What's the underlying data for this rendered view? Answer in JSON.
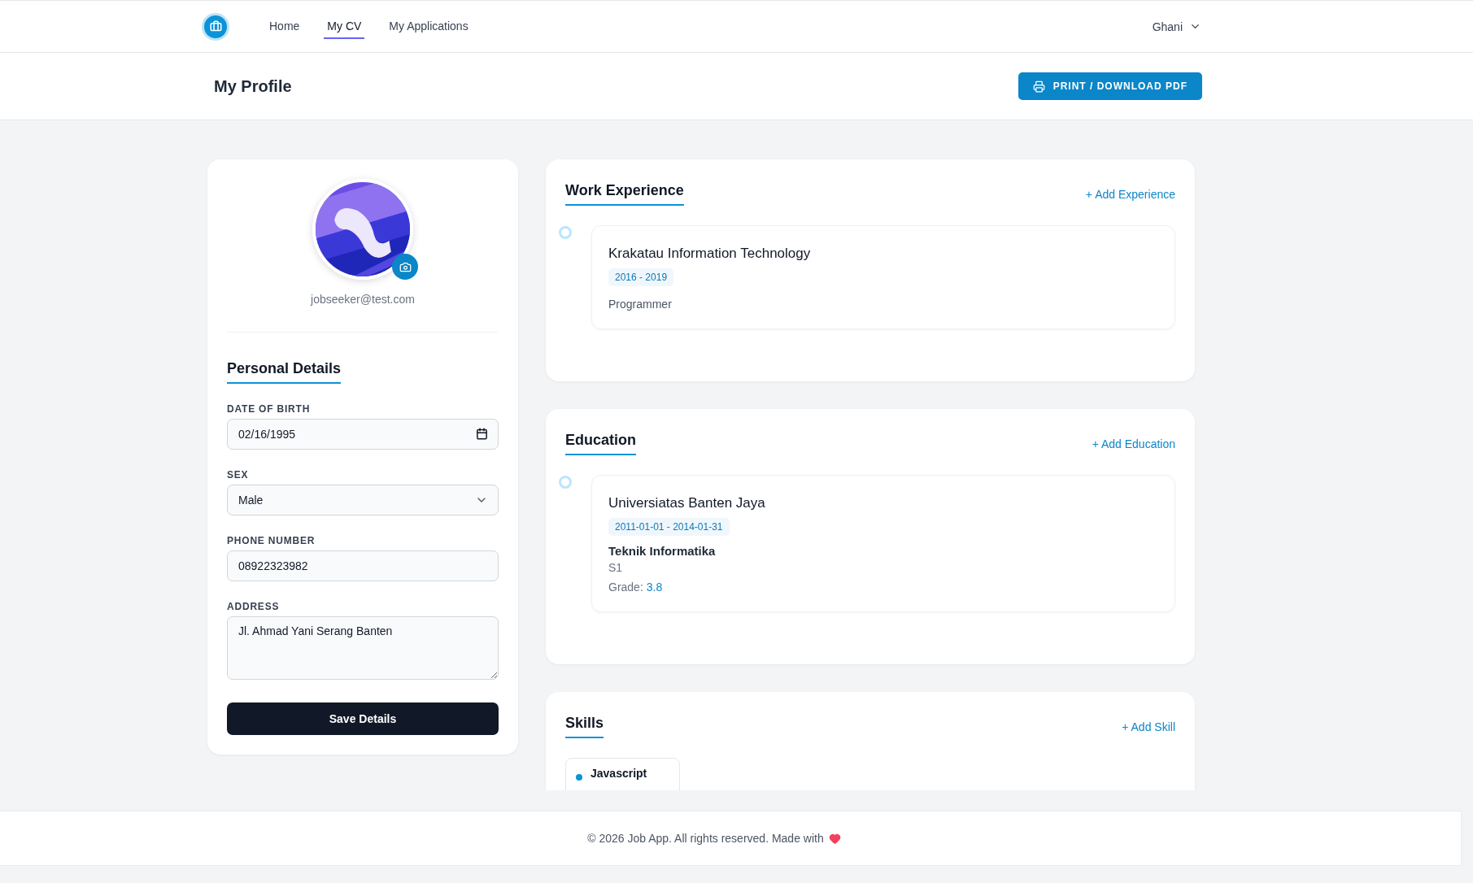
{
  "nav": {
    "links": [
      {
        "label": "Home",
        "selected": false
      },
      {
        "label": "My CV",
        "selected": true
      },
      {
        "label": "My Applications",
        "selected": false
      }
    ],
    "user": "Ghani"
  },
  "page": {
    "title": "My Profile",
    "print_button": "PRINT / DOWNLOAD PDF"
  },
  "profile": {
    "email": "jobseeker@test.com",
    "section_title": "Personal Details",
    "save_button": "Save Details",
    "fields": [
      {
        "label": "DATE OF BIRTH",
        "value": "02/16/1995",
        "kind": "date"
      },
      {
        "label": "SEX",
        "value": "Male",
        "kind": "select"
      },
      {
        "label": "PHONE NUMBER",
        "value": "08922323982",
        "kind": "text"
      },
      {
        "label": "ADDRESS",
        "value": "Jl. Ahmad Yani Serang Banten",
        "kind": "textarea"
      }
    ]
  },
  "sections": [
    {
      "kind": "experience",
      "title": "Work Experience",
      "add_link": "+ Add Experience",
      "items": [
        {
          "name": "Krakatau Information Technology",
          "period": "2016 - 2019",
          "role": "Programmer"
        }
      ]
    },
    {
      "kind": "education",
      "title": "Education",
      "add_link": "+ Add Education",
      "items": [
        {
          "name": "Universiatas Banten Jaya",
          "period": "2011-01-01 - 2014-01-31",
          "major": "Teknik Informatika",
          "degree": "S1",
          "grade_label": "Grade:",
          "grade": "3.8"
        }
      ]
    },
    {
      "kind": "skills",
      "title": "Skills",
      "add_link": "+ Add Skill",
      "items": [
        {
          "name": "Javascript"
        }
      ]
    }
  ],
  "footer": {
    "text": "© 2026 Job App. All rights reserved. Made with"
  }
}
